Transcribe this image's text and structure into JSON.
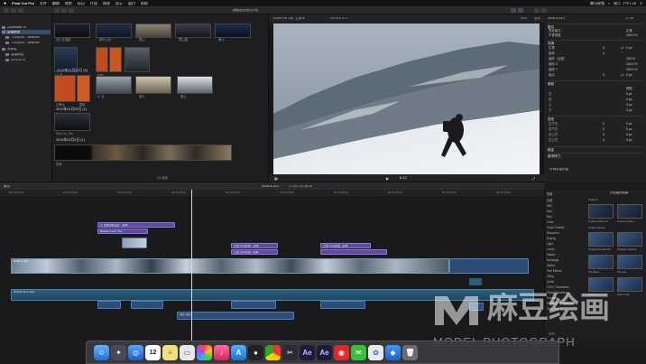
{
  "menubar": {
    "apple": "",
    "app": "Final Cut Pro",
    "items": [
      "文件",
      "编辑",
      "修剪",
      "标记",
      "片段",
      "修改",
      "显示",
      "窗口",
      "帮助"
    ],
    "right_status": "腾讯视频",
    "clock": "周二 下午1:40"
  },
  "toolbar": {
    "hide_rejected": "隐藏被拒绝的片段",
    "viewer_format": "1080p HD 25p, 立体声",
    "title": "2019-4-13 2",
    "zoom": "43%",
    "display": "显示"
  },
  "sidebar": {
    "items": [
      {
        "label": "Quanaxiai 10"
      },
      {
        "label": "智能精选"
      },
      {
        "label": "7130(Aut... Beachel"
      },
      {
        "label": "7130(Aut... Beachel"
      },
      {
        "label": "未命名"
      },
      {
        "label": "智能精选"
      },
      {
        "label": "2019-4-13"
      }
    ]
  },
  "browser": {
    "groups": [
      {
        "date": "2019年01月02日",
        "count": "(5)"
      },
      {
        "date": "2019年01月05日",
        "count": "(1)"
      },
      {
        "date": "2019年03月3日",
        "count": "(1)"
      }
    ],
    "labels": [
      "嘉士达酒精",
      "城市公元",
      "雪山",
      "雪山路",
      "爱心",
      "山 名",
      "Dom",
      "云海山",
      "雪景",
      "小 名",
      "旅行",
      "爱心",
      "Scen_lo_Cla",
      "影像",
      "嘉士达 2"
    ],
    "footer": "1/2 选定"
  },
  "viewer": {
    "format": "1080p HD 25p, 立体声",
    "title": "2019-4-13 2",
    "zoom": "43%",
    "display": "显示",
    "timecode": "6:12"
  },
  "inspector": {
    "title": "2019-4-13 2",
    "duration": "17:18",
    "section_compositing": "复合",
    "blend_mode_label": "混合模式",
    "blend_mode_value": "正常",
    "opacity_label": "不透明度",
    "opacity_value": "100.0 %",
    "section_transform": "变换",
    "rows_transform": [
      {
        "label": "位置",
        "v1": "0",
        "u1": "px",
        "v2": "0 px"
      },
      {
        "label": "旋转",
        "v1": "0",
        "u1": "°",
        "v2": ""
      },
      {
        "label": "缩放（全部）",
        "v1": "100 %",
        "u1": "",
        "v2": ""
      },
      {
        "label": "缩放 X",
        "v1": "100.0 %",
        "u1": "",
        "v2": ""
      },
      {
        "label": "缩放 Y",
        "v1": "100.0 %",
        "u1": "",
        "v2": ""
      },
      {
        "label": "锚点",
        "v1": "0",
        "u1": "px",
        "v2": "0 px"
      }
    ],
    "section_crop": "裁剪",
    "crop_type": "修剪",
    "rows_crop": [
      {
        "label": "左",
        "v": "0 px"
      },
      {
        "label": "右",
        "v": "0 px"
      },
      {
        "label": "上",
        "v": "0 px"
      },
      {
        "label": "下",
        "v": "0 px"
      }
    ],
    "section_distort": "变形",
    "rows_distort": [
      {
        "label": "左下方",
        "v1": "0",
        "v2": "0 px"
      },
      {
        "label": "右下方",
        "v1": "0",
        "v2": "0 px"
      },
      {
        "label": "右上方",
        "v1": "0",
        "v2": "0 px"
      },
      {
        "label": "左上方",
        "v1": "0",
        "v2": "0 px"
      }
    ],
    "section_stabilize": "稳定",
    "section_rolling": "卷帘快门",
    "footer_button": "存储效果预置"
  },
  "timeline": {
    "index_label": "索引",
    "sequence": "2019-4-13 2",
    "duration": "17:18 / 32:16:18",
    "ruler_ticks": [
      "00:00:00:00",
      "00:00:05:00",
      "00:00:10:00",
      "00:00:15:00",
      "00:00:20:00",
      "00:00:25:00",
      "00:00:30:00",
      "00:00:35:00",
      "00:00:40:00",
      "00:00:45:00",
      "00:00:50:00"
    ],
    "titles": [
      {
        "label": "已 爱的目标设计 - 基本"
      },
      {
        "label": "Basket Lower Title"
      },
      {
        "label": "已到 手写标题 - 基本"
      },
      {
        "label": "已到 手写标题 - 基本"
      },
      {
        "label": "已到 手写标题 - 基本"
      }
    ],
    "primary_label": "2019-4-13 2",
    "audio_label": "2019-4-13 2.mp3",
    "audio2_label": "音乐 音乐"
  },
  "effects": {
    "header": "已安装的效果",
    "categories": [
      "视频",
      "全部",
      "360°",
      "Alex",
      "Blur",
      "Color",
      "Color Presets",
      "Distortion",
      "Keying",
      "Light",
      "Looks",
      "Masks",
      "Nostalgia",
      "Stylize",
      "Text Effects",
      "Tiling",
      "Audio",
      "FCPX Transitions",
      "Glass Transitions",
      "Parallax",
      "Rainbow Transitions",
      "Shift Shaper"
    ],
    "tiles": [
      {
        "label": "Custom"
      },
      {
        "label": "Custom Zoom"
      },
      {
        "label": "Custom Zoom In"
      },
      {
        "label": "Custom Zoom..."
      },
      {
        "label": "Straight Horizontal"
      },
      {
        "label": "Straight Vertical"
      },
      {
        "label": "Tilt Down"
      },
      {
        "label": "Tilt Left"
      },
      {
        "label": "Zoom In"
      },
      {
        "label": "Zoom Out"
      }
    ],
    "search": "搜索"
  },
  "dock": {
    "icons": [
      "finder-icon",
      "launchpad-icon",
      "safari-icon",
      "calendar-icon",
      "notes-icon",
      "preview-icon",
      "photos-icon",
      "music-icon",
      "appstore-icon",
      "qq-icon",
      "chrome-icon",
      "final-cut-pro-icon",
      "after-effects-icon",
      "after-effects-2-icon",
      "netease-music-icon",
      "wechat-icon",
      "baidu-icon",
      "tencent-icon",
      "trash-icon"
    ],
    "calendar_day": "12"
  },
  "watermark": {
    "brand": "麻豆绘画",
    "sub": "MODEL PHOTOGRAPH"
  }
}
